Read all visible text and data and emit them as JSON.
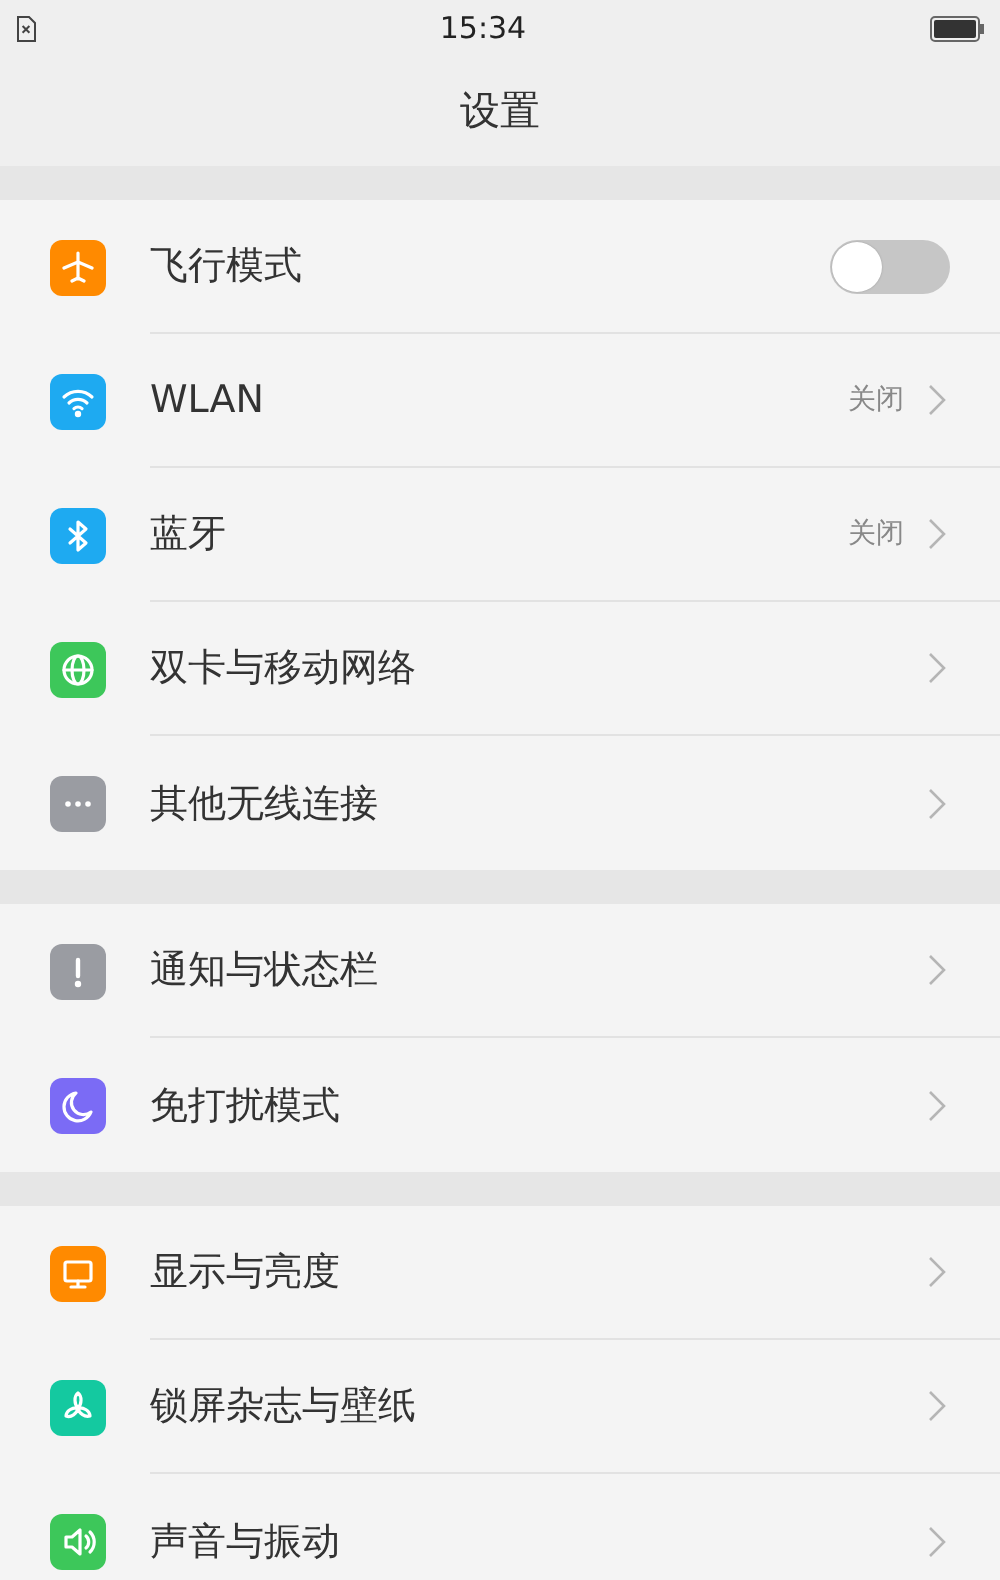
{
  "status_bar": {
    "time": "15:34"
  },
  "title": "设置",
  "groups": [
    {
      "items": [
        {
          "label": "飞行模式",
          "color": "#ff8a00",
          "kind": "toggle",
          "on": false
        },
        {
          "label": "WLAN",
          "color": "#1eaaf1",
          "kind": "link",
          "value": "关闭"
        },
        {
          "label": "蓝牙",
          "color": "#1eaaf1",
          "kind": "link",
          "value": "关闭"
        },
        {
          "label": "双卡与移动网络",
          "color": "#3dc75a",
          "kind": "link"
        },
        {
          "label": "其他无线连接",
          "color": "#9a9ca2",
          "kind": "link"
        }
      ]
    },
    {
      "items": [
        {
          "label": "通知与状态栏",
          "color": "#9a9ca2",
          "kind": "link"
        },
        {
          "label": "免打扰模式",
          "color": "#7b6bf5",
          "kind": "link"
        }
      ]
    },
    {
      "items": [
        {
          "label": "显示与亮度",
          "color": "#ff8a00",
          "kind": "link"
        },
        {
          "label": "锁屏杂志与壁纸",
          "color": "#14c9a0",
          "kind": "link"
        },
        {
          "label": "声音与振动",
          "color": "#3dc75a",
          "kind": "link"
        }
      ]
    }
  ]
}
